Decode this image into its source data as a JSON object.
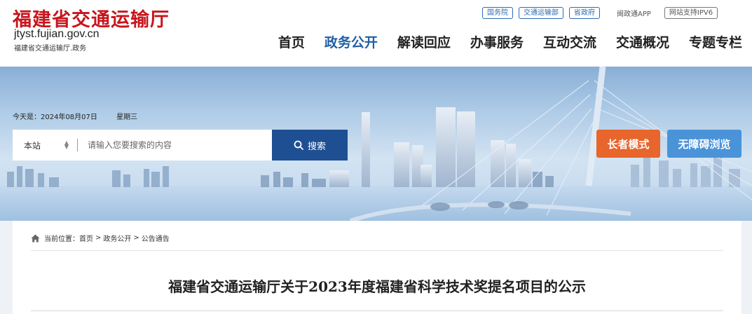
{
  "site": {
    "name": "福建省交通运输厅",
    "url": "jtyst.fujian.gov.cn",
    "subtitle": "福建省交通运输厅.政务"
  },
  "top_links": {
    "state_council": "国务院",
    "mot": "交通运输部",
    "provincial_gov": "省政府",
    "app": "闽政通APP",
    "ipv6": "网站支持IPV6"
  },
  "nav": {
    "items": [
      "首页",
      "政务公开",
      "解读回应",
      "办事服务",
      "互动交流",
      "交通概况",
      "专题专栏"
    ],
    "active_index": 1
  },
  "banner": {
    "date_label": "今天是：2024年08月07日",
    "weekday": "星期三"
  },
  "search": {
    "scope": "本站",
    "placeholder": "请输入您要搜索的内容",
    "button_label": "搜索"
  },
  "modes": {
    "elder": "长者模式",
    "accessible": "无障碍浏览"
  },
  "breadcrumb": {
    "prefix": "当前位置：",
    "items": [
      "首页",
      "政务公开",
      "公告通告"
    ],
    "separator": ">"
  },
  "article": {
    "title": "福建省交通运输厅关于2023年度福建省科学技术奖提名项目的公示"
  },
  "colors": {
    "brand_red": "#c8151d",
    "nav_active": "#1f5fa6",
    "search_button": "#1f4f93",
    "elder_button": "#e8652b",
    "accessible_button": "#4a93d8"
  },
  "icons": [
    "search-icon",
    "home-icon",
    "sort-arrows-icon"
  ]
}
